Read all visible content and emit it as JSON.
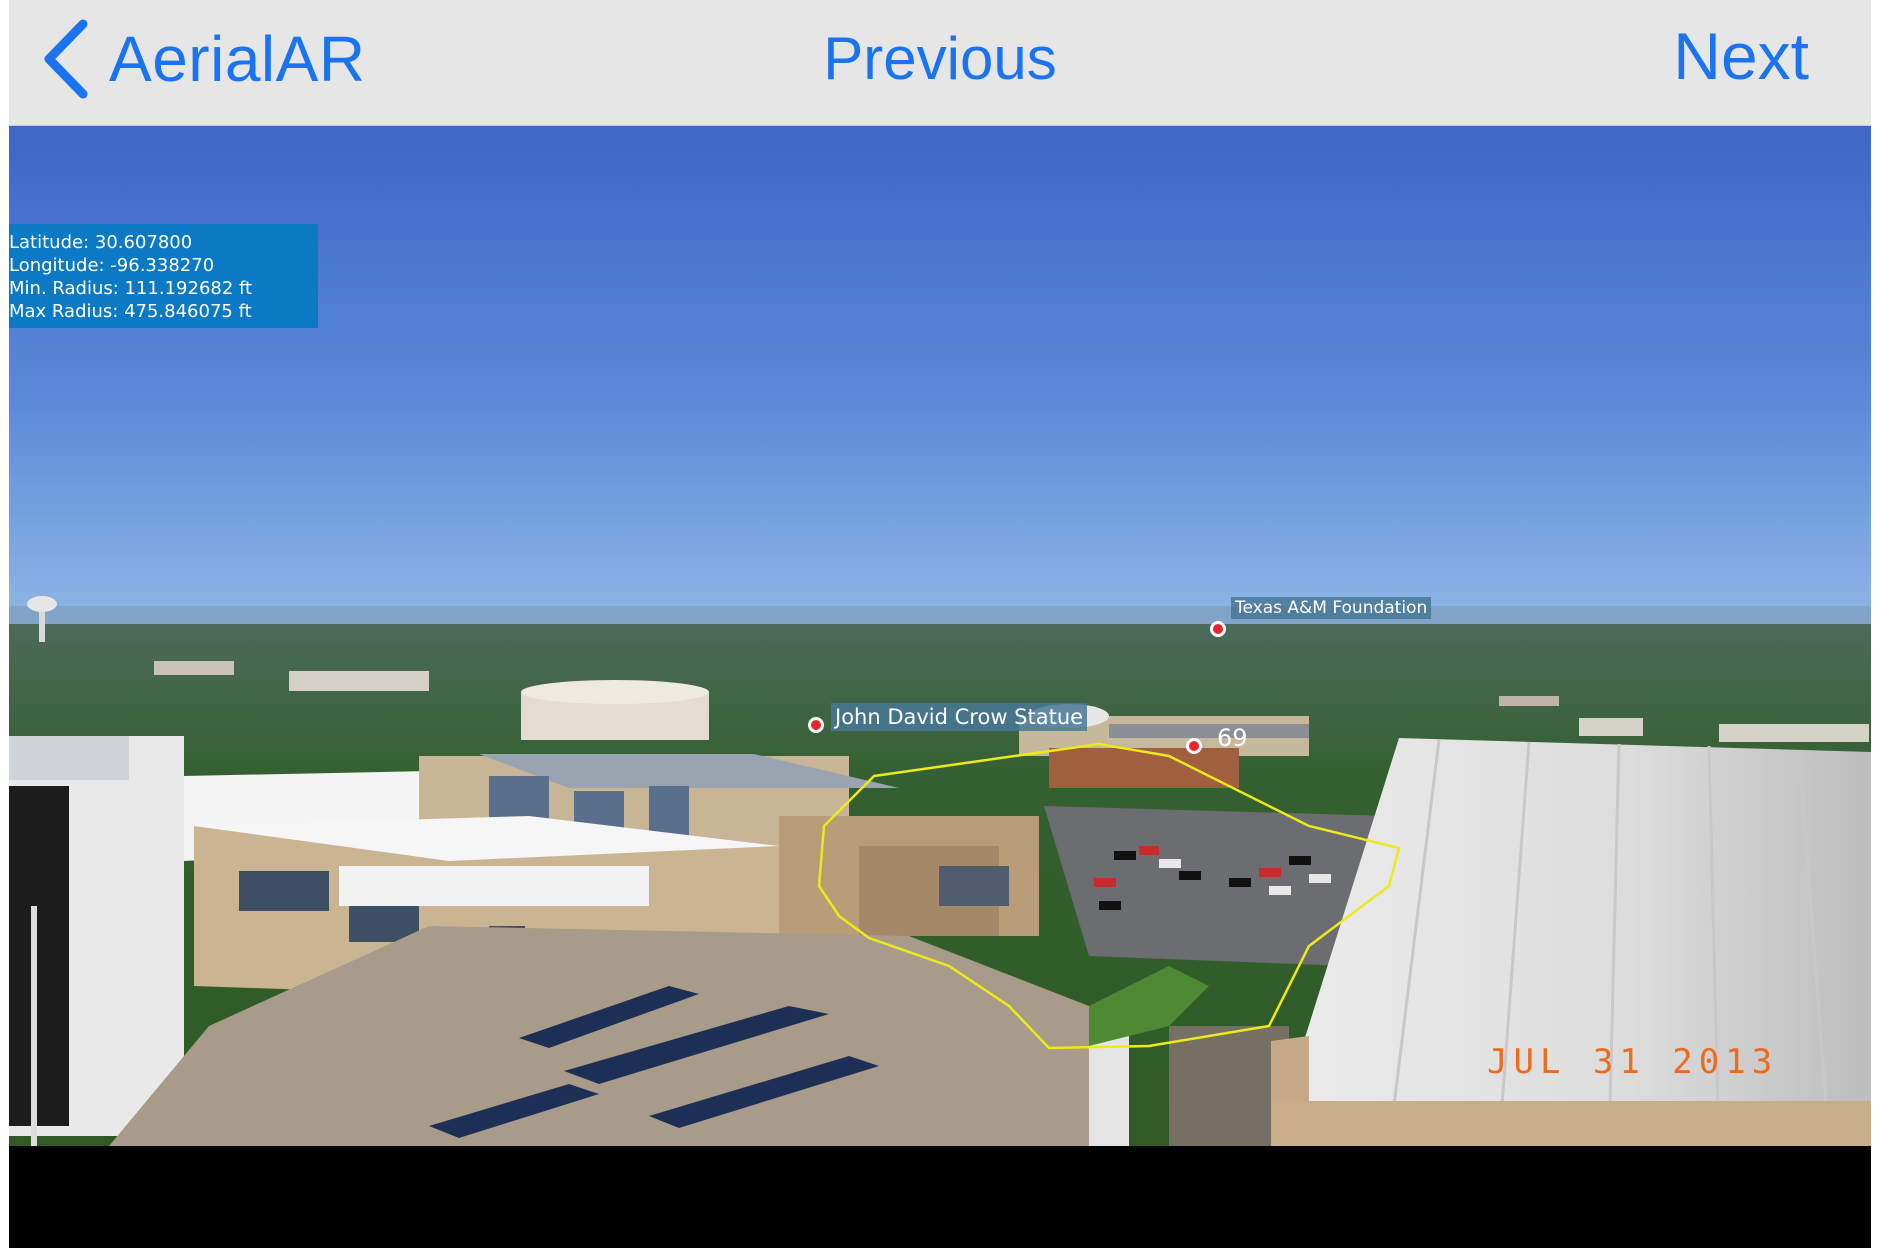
{
  "nav": {
    "back_label": "AerialAR",
    "previous_label": "Previous",
    "next_label": "Next",
    "accent_color": "#1a73f0"
  },
  "info": {
    "latitude": "Latitude: 30.607800",
    "longitude": "Longitude: -96.338270",
    "min_radius": "Min. Radius: 111.192682 ft",
    "max_radius": "Max Radius: 475.846075 ft"
  },
  "poi": {
    "crow_statue": "John David Crow Statue",
    "foundation": "Texas A&M Foundation",
    "count": "69"
  },
  "photo": {
    "date_stamp": "JUL  31  2013"
  },
  "icons": {
    "back": "chevron-left-icon",
    "marker": "map-pin-dot-icon"
  }
}
